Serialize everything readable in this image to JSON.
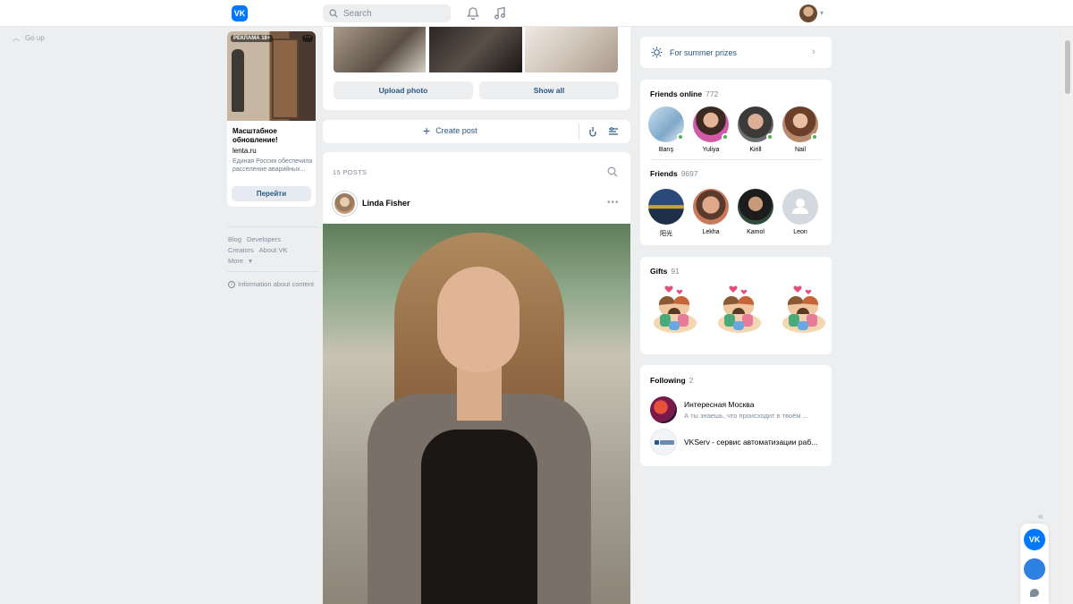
{
  "header": {
    "search_placeholder": "Search"
  },
  "left": {
    "go_up": "Go up",
    "ad": {
      "badge": "РЕКЛАМА 18+",
      "title": "Масштабное обновление!",
      "domain": "lenta.ru",
      "description": "Единая Россия обеспечила расселение аварийных...",
      "button": "Перейти"
    },
    "footer": {
      "links": [
        "Blog",
        "Developers",
        "Creators",
        "About VK",
        "More"
      ],
      "info": "Information about content"
    }
  },
  "center": {
    "upload_photo": "Upload photo",
    "show_all": "Show all",
    "create_post": "Create post",
    "posts_count": "15 POSTS",
    "post_author": "Linda Fisher"
  },
  "right": {
    "summer_prizes": "For summer prizes",
    "friends_online": {
      "title": "Friends online",
      "count": "772",
      "items": [
        {
          "name": "Barış"
        },
        {
          "name": "Yuliya"
        },
        {
          "name": "Kirill"
        },
        {
          "name": "Nail"
        }
      ]
    },
    "friends": {
      "title": "Friends",
      "count": "9697",
      "items": [
        {
          "name": "阳光"
        },
        {
          "name": "Lekha"
        },
        {
          "name": "Kamol"
        },
        {
          "name": "Leon"
        }
      ]
    },
    "gifts": {
      "title": "Gifts",
      "count": "91"
    },
    "following": {
      "title": "Following",
      "count": "2",
      "items": [
        {
          "name": "Интересная Москва",
          "desc": "А ты знаешь, что происходит в твоём ..."
        },
        {
          "name": "VKServ - сервис автоматизации раб...",
          "desc": ""
        }
      ]
    }
  },
  "colors": {
    "accent": "#0077ff",
    "link": "#2a5885",
    "online": "#4bb34b",
    "bg": "#edeef0"
  }
}
